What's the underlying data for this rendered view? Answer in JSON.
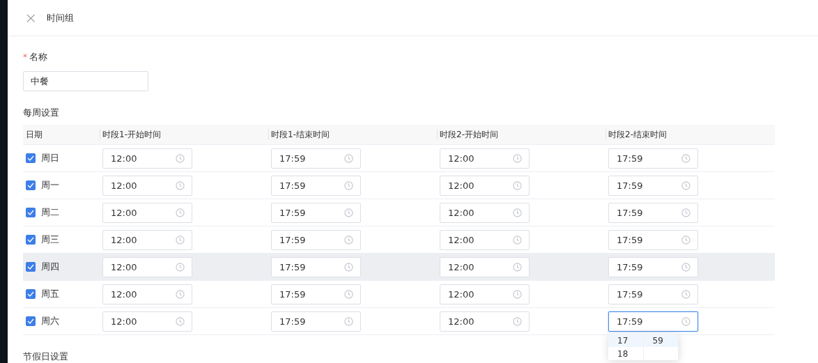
{
  "header": {
    "close": "×",
    "title": "时间组"
  },
  "name_field": {
    "required_mark": "*",
    "label": "名称",
    "value": "中餐"
  },
  "weekly": {
    "title": "每周设置",
    "columns": [
      "日期",
      "时段1-开始时间",
      "时段1-结束时间",
      "时段2-开始时间",
      "时段2-结束时间"
    ],
    "rows": [
      {
        "day": "周日",
        "checked": true,
        "highlighted": false,
        "times": [
          {
            "value": "12:00",
            "focused": false
          },
          {
            "value": "17:59",
            "focused": false
          },
          {
            "value": "12:00",
            "focused": false
          },
          {
            "value": "17:59",
            "focused": false
          }
        ]
      },
      {
        "day": "周一",
        "checked": true,
        "highlighted": false,
        "times": [
          {
            "value": "12:00",
            "focused": false
          },
          {
            "value": "17:59",
            "focused": false
          },
          {
            "value": "12:00",
            "focused": false
          },
          {
            "value": "17:59",
            "focused": false
          }
        ]
      },
      {
        "day": "周二",
        "checked": true,
        "highlighted": false,
        "times": [
          {
            "value": "12:00",
            "focused": false
          },
          {
            "value": "17:59",
            "focused": false
          },
          {
            "value": "12:00",
            "focused": false
          },
          {
            "value": "17:59",
            "focused": false
          }
        ]
      },
      {
        "day": "周三",
        "checked": true,
        "highlighted": false,
        "times": [
          {
            "value": "12:00",
            "focused": false
          },
          {
            "value": "17:59",
            "focused": false
          },
          {
            "value": "12:00",
            "focused": false
          },
          {
            "value": "17:59",
            "focused": false
          }
        ]
      },
      {
        "day": "周四",
        "checked": true,
        "highlighted": true,
        "times": [
          {
            "value": "12:00",
            "focused": false
          },
          {
            "value": "17:59",
            "focused": false
          },
          {
            "value": "12:00",
            "focused": false
          },
          {
            "value": "17:59",
            "focused": false
          }
        ]
      },
      {
        "day": "周五",
        "checked": true,
        "highlighted": false,
        "times": [
          {
            "value": "12:00",
            "focused": false
          },
          {
            "value": "17:59",
            "focused": false
          },
          {
            "value": "12:00",
            "focused": false
          },
          {
            "value": "17:59",
            "focused": false
          }
        ]
      },
      {
        "day": "周六",
        "checked": true,
        "highlighted": false,
        "times": [
          {
            "value": "12:00",
            "focused": false
          },
          {
            "value": "17:59",
            "focused": false
          },
          {
            "value": "12:00",
            "focused": false
          },
          {
            "value": "17:59",
            "focused": true
          }
        ]
      }
    ]
  },
  "time_picker": {
    "hours": [
      {
        "label": "17",
        "selected": true
      },
      {
        "label": "18",
        "selected": false
      }
    ],
    "minutes": [
      {
        "label": "59",
        "selected": true
      }
    ]
  },
  "holiday": {
    "title": "节假日设置"
  }
}
